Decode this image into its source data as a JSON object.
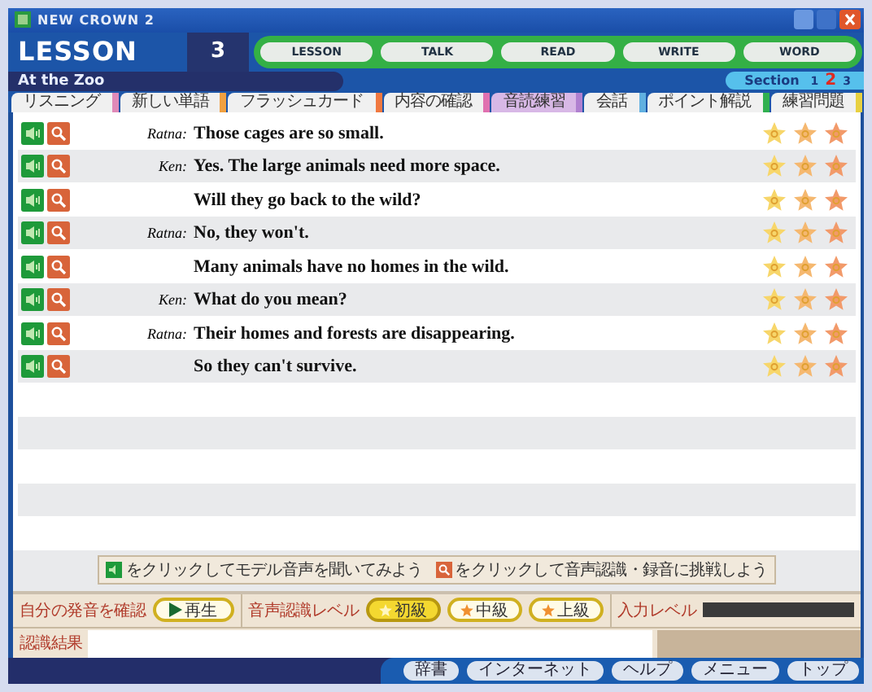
{
  "window": {
    "title": "NEW CROWN 2"
  },
  "lesson": {
    "label": "LESSON",
    "number": "3"
  },
  "nav_buttons": [
    "LESSON",
    "TALK",
    "READ",
    "WRITE",
    "WORD"
  ],
  "unit_title": "At the Zoo",
  "section": {
    "label": "Section",
    "pages": [
      {
        "label": "1",
        "selected": false
      },
      {
        "label": "2",
        "selected": true
      },
      {
        "label": "3",
        "selected": false
      }
    ]
  },
  "tabs": [
    {
      "label": "リスニング",
      "selected": false,
      "color": "#e08ab8"
    },
    {
      "label": "新しい単語",
      "selected": false,
      "color": "#f0a040"
    },
    {
      "label": "フラッシュカード",
      "selected": false,
      "color": "#f07840"
    },
    {
      "label": "内容の確認",
      "selected": false,
      "color": "#e070b0"
    },
    {
      "label": "音読練習",
      "selected": true,
      "color": "#b080d0"
    },
    {
      "label": "会話",
      "selected": false,
      "color": "#60b0e0"
    },
    {
      "label": "ポイント解説",
      "selected": false,
      "color": "#30b050"
    },
    {
      "label": "練習問題",
      "selected": false,
      "color": "#e8d040"
    }
  ],
  "dialogue": [
    {
      "speaker": "Ratna:",
      "line": "Those cages are so small."
    },
    {
      "speaker": "Ken:",
      "line": "Yes. The large animals need more space."
    },
    {
      "line": "Will they go back to the wild?"
    },
    {
      "speaker": "Ratna:",
      "line": "No, they won't."
    },
    {
      "line": "Many animals have no homes in the wild."
    },
    {
      "speaker": "Ken:",
      "line": "What do you mean?"
    },
    {
      "speaker": "Ratna:",
      "line": "Their homes and forests are disappearing."
    },
    {
      "line": "So they can't survive."
    }
  ],
  "hint": [
    "をクリックしてモデル音声を聞いてみよう",
    "をクリックして音声認識・録音に挑戦しよう"
  ],
  "controls": {
    "playback_label": "自分の発音を確認",
    "play_button": "再生",
    "level_label": "音声認識レベル",
    "levels": [
      {
        "label": "初級",
        "selected": true
      },
      {
        "label": "中級",
        "selected": false
      },
      {
        "label": "上級",
        "selected": false
      }
    ],
    "input_label": "入力レベル"
  },
  "result": {
    "label": "認識結果"
  },
  "footer_buttons": [
    "辞書",
    "インターネット",
    "ヘルプ",
    "メニュー",
    "トップ"
  ]
}
